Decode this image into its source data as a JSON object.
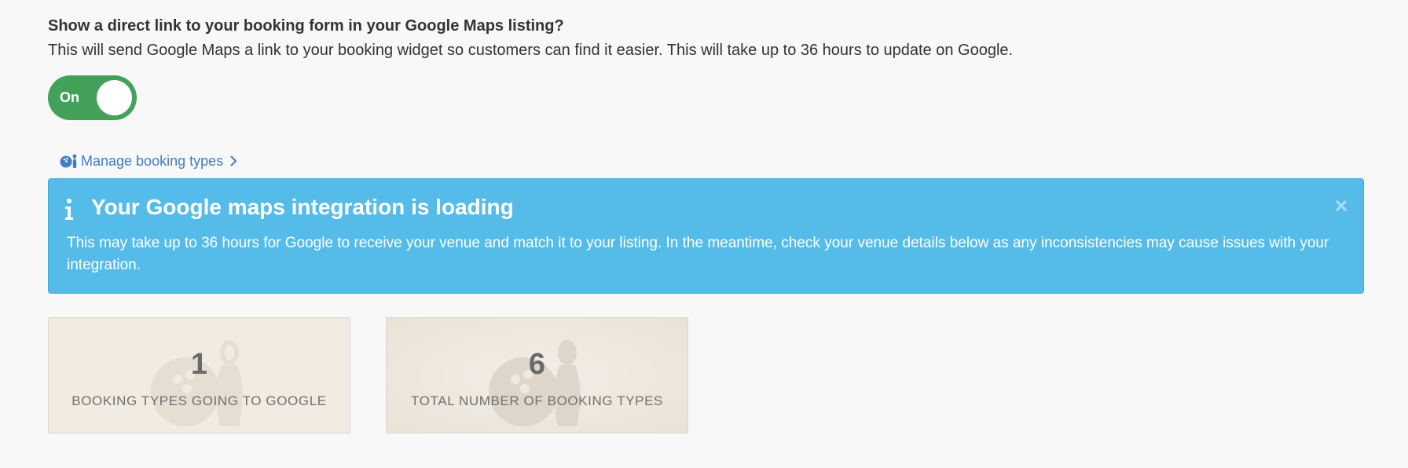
{
  "setting": {
    "title": "Show a direct link to your booking form in your Google Maps listing?",
    "description": "This will send Google Maps a link to your booking widget so customers can find it easier. This will take up to 36 hours to update on Google.",
    "toggle_label": "On",
    "toggle_state": "on",
    "toggle_color": "#43a15a"
  },
  "manage_link": {
    "label": "Manage booking types",
    "icon": "bowling-icon",
    "color": "#3d7fc2"
  },
  "alert": {
    "icon": "info-icon",
    "title": "Your Google maps integration is loading",
    "body": "This may take up to 36 hours for Google to receive your venue and match it to your listing. In the meantime, check your venue details below as any inconsistencies may cause issues with your integration.",
    "close_icon": "close-icon",
    "color": "#55bcea"
  },
  "stats": [
    {
      "value": "1",
      "label": "BOOKING TYPES GOING TO GOOGLE",
      "icon": "bowling-icon"
    },
    {
      "value": "6",
      "label": "TOTAL NUMBER OF BOOKING TYPES",
      "icon": "bowling-icon"
    }
  ]
}
